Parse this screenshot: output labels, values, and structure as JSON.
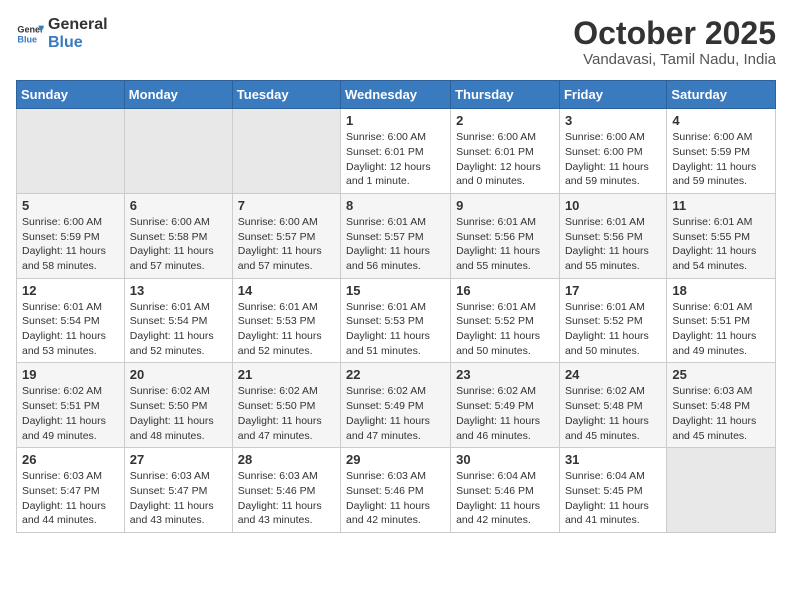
{
  "header": {
    "logo_general": "General",
    "logo_blue": "Blue",
    "month_title": "October 2025",
    "location": "Vandavasi, Tamil Nadu, India"
  },
  "weekdays": [
    "Sunday",
    "Monday",
    "Tuesday",
    "Wednesday",
    "Thursday",
    "Friday",
    "Saturday"
  ],
  "weeks": [
    [
      {
        "day": "",
        "info": ""
      },
      {
        "day": "",
        "info": ""
      },
      {
        "day": "",
        "info": ""
      },
      {
        "day": "1",
        "info": "Sunrise: 6:00 AM\nSunset: 6:01 PM\nDaylight: 12 hours\nand 1 minute."
      },
      {
        "day": "2",
        "info": "Sunrise: 6:00 AM\nSunset: 6:01 PM\nDaylight: 12 hours\nand 0 minutes."
      },
      {
        "day": "3",
        "info": "Sunrise: 6:00 AM\nSunset: 6:00 PM\nDaylight: 11 hours\nand 59 minutes."
      },
      {
        "day": "4",
        "info": "Sunrise: 6:00 AM\nSunset: 5:59 PM\nDaylight: 11 hours\nand 59 minutes."
      }
    ],
    [
      {
        "day": "5",
        "info": "Sunrise: 6:00 AM\nSunset: 5:59 PM\nDaylight: 11 hours\nand 58 minutes."
      },
      {
        "day": "6",
        "info": "Sunrise: 6:00 AM\nSunset: 5:58 PM\nDaylight: 11 hours\nand 57 minutes."
      },
      {
        "day": "7",
        "info": "Sunrise: 6:00 AM\nSunset: 5:57 PM\nDaylight: 11 hours\nand 57 minutes."
      },
      {
        "day": "8",
        "info": "Sunrise: 6:01 AM\nSunset: 5:57 PM\nDaylight: 11 hours\nand 56 minutes."
      },
      {
        "day": "9",
        "info": "Sunrise: 6:01 AM\nSunset: 5:56 PM\nDaylight: 11 hours\nand 55 minutes."
      },
      {
        "day": "10",
        "info": "Sunrise: 6:01 AM\nSunset: 5:56 PM\nDaylight: 11 hours\nand 55 minutes."
      },
      {
        "day": "11",
        "info": "Sunrise: 6:01 AM\nSunset: 5:55 PM\nDaylight: 11 hours\nand 54 minutes."
      }
    ],
    [
      {
        "day": "12",
        "info": "Sunrise: 6:01 AM\nSunset: 5:54 PM\nDaylight: 11 hours\nand 53 minutes."
      },
      {
        "day": "13",
        "info": "Sunrise: 6:01 AM\nSunset: 5:54 PM\nDaylight: 11 hours\nand 52 minutes."
      },
      {
        "day": "14",
        "info": "Sunrise: 6:01 AM\nSunset: 5:53 PM\nDaylight: 11 hours\nand 52 minutes."
      },
      {
        "day": "15",
        "info": "Sunrise: 6:01 AM\nSunset: 5:53 PM\nDaylight: 11 hours\nand 51 minutes."
      },
      {
        "day": "16",
        "info": "Sunrise: 6:01 AM\nSunset: 5:52 PM\nDaylight: 11 hours\nand 50 minutes."
      },
      {
        "day": "17",
        "info": "Sunrise: 6:01 AM\nSunset: 5:52 PM\nDaylight: 11 hours\nand 50 minutes."
      },
      {
        "day": "18",
        "info": "Sunrise: 6:01 AM\nSunset: 5:51 PM\nDaylight: 11 hours\nand 49 minutes."
      }
    ],
    [
      {
        "day": "19",
        "info": "Sunrise: 6:02 AM\nSunset: 5:51 PM\nDaylight: 11 hours\nand 49 minutes."
      },
      {
        "day": "20",
        "info": "Sunrise: 6:02 AM\nSunset: 5:50 PM\nDaylight: 11 hours\nand 48 minutes."
      },
      {
        "day": "21",
        "info": "Sunrise: 6:02 AM\nSunset: 5:50 PM\nDaylight: 11 hours\nand 47 minutes."
      },
      {
        "day": "22",
        "info": "Sunrise: 6:02 AM\nSunset: 5:49 PM\nDaylight: 11 hours\nand 47 minutes."
      },
      {
        "day": "23",
        "info": "Sunrise: 6:02 AM\nSunset: 5:49 PM\nDaylight: 11 hours\nand 46 minutes."
      },
      {
        "day": "24",
        "info": "Sunrise: 6:02 AM\nSunset: 5:48 PM\nDaylight: 11 hours\nand 45 minutes."
      },
      {
        "day": "25",
        "info": "Sunrise: 6:03 AM\nSunset: 5:48 PM\nDaylight: 11 hours\nand 45 minutes."
      }
    ],
    [
      {
        "day": "26",
        "info": "Sunrise: 6:03 AM\nSunset: 5:47 PM\nDaylight: 11 hours\nand 44 minutes."
      },
      {
        "day": "27",
        "info": "Sunrise: 6:03 AM\nSunset: 5:47 PM\nDaylight: 11 hours\nand 43 minutes."
      },
      {
        "day": "28",
        "info": "Sunrise: 6:03 AM\nSunset: 5:46 PM\nDaylight: 11 hours\nand 43 minutes."
      },
      {
        "day": "29",
        "info": "Sunrise: 6:03 AM\nSunset: 5:46 PM\nDaylight: 11 hours\nand 42 minutes."
      },
      {
        "day": "30",
        "info": "Sunrise: 6:04 AM\nSunset: 5:46 PM\nDaylight: 11 hours\nand 42 minutes."
      },
      {
        "day": "31",
        "info": "Sunrise: 6:04 AM\nSunset: 5:45 PM\nDaylight: 11 hours\nand 41 minutes."
      },
      {
        "day": "",
        "info": ""
      }
    ]
  ]
}
